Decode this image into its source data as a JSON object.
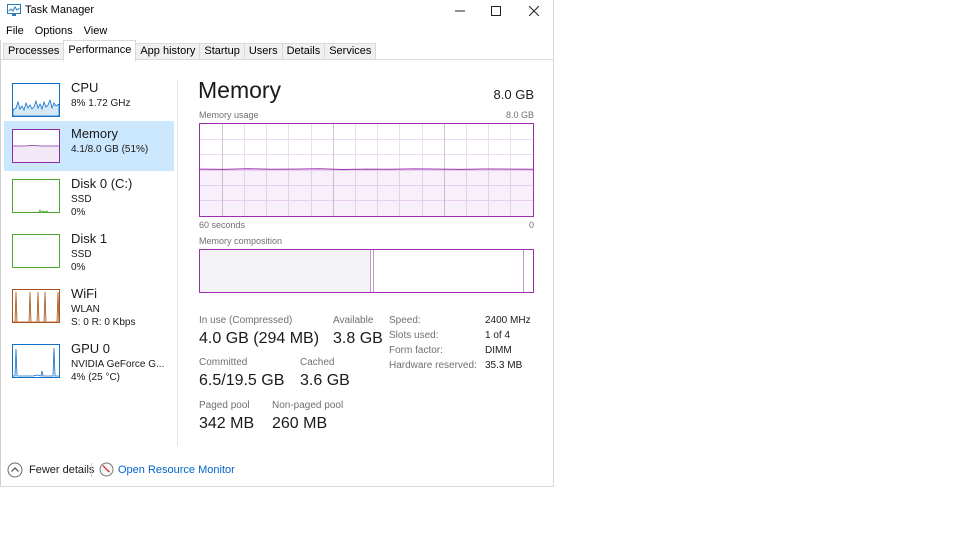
{
  "window": {
    "title": "Task Manager"
  },
  "menu": [
    "File",
    "Options",
    "View"
  ],
  "tabs": [
    "Processes",
    "Performance",
    "App history",
    "Startup",
    "Users",
    "Details",
    "Services"
  ],
  "active_tab": "Performance",
  "sidebar": [
    {
      "name": "CPU",
      "lines": [
        "8%  1.72 GHz"
      ],
      "color": "#1170c8"
    },
    {
      "name": "Memory",
      "lines": [
        "4.1/8.0 GB (51%)"
      ],
      "color": "#8b2fa8"
    },
    {
      "name": "Disk 0 (C:)",
      "lines": [
        "SSD",
        "0%"
      ],
      "color": "#4da632"
    },
    {
      "name": "Disk 1",
      "lines": [
        "SSD",
        "0%"
      ],
      "color": "#4da632"
    },
    {
      "name": "WiFi",
      "lines": [
        "WLAN",
        "S: 0 R: 0 Kbps"
      ],
      "color": "#a7531b"
    },
    {
      "name": "GPU 0",
      "lines": [
        "NVIDIA GeForce G...",
        "4%  (25 °C)"
      ],
      "color": "#1170c8"
    }
  ],
  "selected_sidebar": "Memory",
  "main": {
    "title": "Memory",
    "total": "8.0 GB",
    "usage_label": "Memory usage",
    "usage_max": "8.0 GB",
    "time_left": "60 seconds",
    "time_right": "0",
    "usage_fraction": 0.51,
    "composition_label": "Memory composition",
    "composition_in_use_fraction": 0.51,
    "stats": {
      "in_use_label": "In use (Compressed)",
      "in_use_value": "4.0 GB (294 MB)",
      "available_label": "Available",
      "available_value": "3.8 GB",
      "committed_label": "Committed",
      "committed_value": "6.5/19.5 GB",
      "cached_label": "Cached",
      "cached_value": "3.6 GB",
      "paged_label": "Paged pool",
      "paged_value": "342 MB",
      "nonpaged_label": "Non-paged pool",
      "nonpaged_value": "260 MB"
    },
    "specs": [
      {
        "label": "Speed:",
        "value": "2400 MHz"
      },
      {
        "label": "Slots used:",
        "value": "1 of 4"
      },
      {
        "label": "Form factor:",
        "value": "DIMM"
      },
      {
        "label": "Hardware reserved:",
        "value": "35.3 MB"
      }
    ]
  },
  "footer": {
    "fewer_details": "Fewer details",
    "open_monitor": "Open Resource Monitor"
  },
  "colors": {
    "memory": "#9b2fae",
    "selected_bg": "#cce8ff",
    "link": "#0066cc"
  }
}
